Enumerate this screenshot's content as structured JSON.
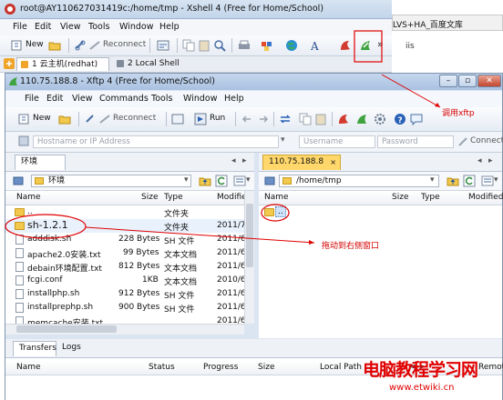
{
  "xshell": {
    "title": "root@AY11062703141 9c:/home/tmp - Xshell 4 (Free for Home/School)",
    "title_display": "root@AY110627031419c:/home/tmp - Xshell 4 (Free for Home/School)",
    "menu": [
      "File",
      "Edit",
      "View",
      "Tools",
      "Window",
      "Help"
    ],
    "toolbar": {
      "new_label": "New",
      "reconnect_label": "Reconnect"
    },
    "sessions": [
      {
        "label": "1 云主机(redhat)"
      },
      {
        "label": "2 Local Shell"
      }
    ],
    "more_glyph": "»"
  },
  "background_window": {
    "tab_text": "LVS+HA_百度文库",
    "text": "iis"
  },
  "xftp": {
    "title": "110.75.188.8 - Xftp 4 (Free for Home/School)",
    "menu": [
      "File",
      "Edit",
      "View",
      "Commands",
      "Tools",
      "Window",
      "Help"
    ],
    "toolbar": {
      "new_label": "New",
      "reconnect_label": "Reconnect",
      "run_label": "Run"
    },
    "address": {
      "host_placeholder": "Hostname or IP Address",
      "user_placeholder": "Username",
      "password_placeholder": "Password",
      "connect_label": "Connect"
    },
    "local": {
      "tab": "环境",
      "path": "环境",
      "columns": [
        "Name",
        "Size",
        "Type",
        "Modifie"
      ],
      "rows": [
        {
          "name": "..",
          "size": "",
          "type": "文件夹",
          "modified": "",
          "kind": "folder"
        },
        {
          "name": "sh-1.2.1",
          "size": "",
          "type": "文件夹",
          "modified": "2011/7",
          "kind": "folder"
        },
        {
          "name": "adddisk.sh",
          "size": "228 Bytes",
          "type": "SH 文件",
          "modified": "2011/6",
          "kind": "file"
        },
        {
          "name": "apache2.0安装.txt",
          "size": "99 Bytes",
          "type": "文本文档",
          "modified": "2011/6",
          "kind": "file"
        },
        {
          "name": "debain环境配置.txt",
          "size": "812 Bytes",
          "type": "文本文档",
          "modified": "2011/6",
          "kind": "file"
        },
        {
          "name": "fcgi.conf",
          "size": "1KB",
          "type": "文本文档",
          "modified": "2010/6",
          "kind": "file"
        },
        {
          "name": "installphp.sh",
          "size": "912 Bytes",
          "type": "SH 文件",
          "modified": "2011/6",
          "kind": "file"
        },
        {
          "name": "installprephp.sh",
          "size": "900 Bytes",
          "type": "SH 文件",
          "modified": "2011/6",
          "kind": "file"
        },
        {
          "name": "memcache安装.txt",
          "size": "",
          "type": "",
          "modified": "2011/6",
          "kind": "file"
        }
      ]
    },
    "remote": {
      "tab": "110.75.188.8",
      "path": "/home/tmp",
      "columns": [
        "Name",
        "Size",
        "Type",
        "Modified"
      ],
      "rows": [
        {
          "name": "..",
          "kind": "folder"
        }
      ]
    },
    "transfers": {
      "tabs": [
        "Transfers",
        "Logs"
      ],
      "columns": [
        "Name",
        "Status",
        "Progress",
        "Size",
        "Local Path",
        "<->",
        "Remot"
      ]
    }
  },
  "annotations": {
    "call_xftp": "调用xftp",
    "drag_to_right": "拖动到右侧窗口"
  },
  "watermark": {
    "cn": "电脑教程学习网",
    "url": "www.etwiki.cn"
  },
  "colors": {
    "annotation": "#d40000",
    "selection": "#cde3fb",
    "active_tab": "#ffd76a"
  }
}
